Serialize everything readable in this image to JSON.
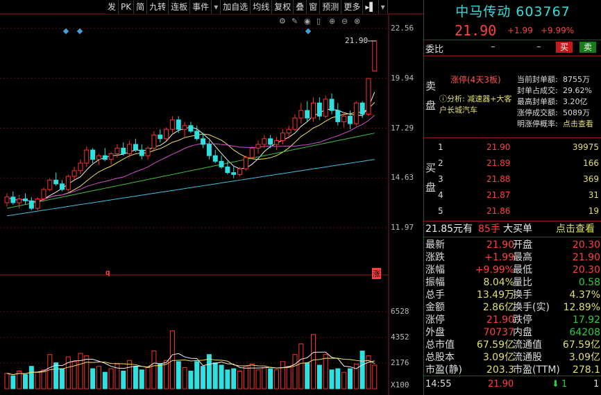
{
  "toolbar": [
    "发",
    "PK",
    "简",
    "九转",
    "连板",
    "事件",
    "▾",
    "加自选",
    "均线",
    "复权",
    "叠",
    "窗",
    "预测",
    "更多",
    "▸▌",
    "▾"
  ],
  "chart_data": {
    "type": "candlestick",
    "price_axis": [
      "22.56",
      "19.94",
      "17.29",
      "14.63",
      "11.97"
    ],
    "volume_axis": [
      "6528",
      "4352",
      "2176"
    ],
    "volume_unit": "X100",
    "high_label": "21.90",
    "markers": [
      "q",
      "涨"
    ],
    "candles": [
      [
        13.3,
        13.8,
        13.1,
        13.6
      ],
      [
        13.6,
        13.9,
        13.2,
        13.3
      ],
      [
        13.3,
        13.7,
        13.0,
        13.5
      ],
      [
        13.5,
        13.8,
        13.2,
        13.4
      ],
      [
        13.4,
        13.6,
        12.9,
        13.0
      ],
      [
        13.0,
        13.6,
        12.9,
        13.5
      ],
      [
        13.5,
        14.1,
        13.4,
        14.0
      ],
      [
        14.0,
        14.6,
        13.9,
        14.5
      ],
      [
        14.5,
        14.9,
        14.2,
        14.3
      ],
      [
        14.3,
        14.5,
        13.9,
        14.0
      ],
      [
        14.0,
        14.8,
        13.9,
        14.7
      ],
      [
        14.7,
        15.2,
        14.5,
        15.0
      ],
      [
        15.0,
        15.6,
        14.8,
        15.4
      ],
      [
        15.4,
        16.3,
        15.2,
        16.1
      ],
      [
        16.1,
        16.2,
        15.4,
        15.6
      ],
      [
        15.6,
        15.9,
        15.3,
        15.8
      ],
      [
        15.8,
        16.2,
        15.5,
        15.6
      ],
      [
        15.6,
        16.0,
        15.3,
        15.9
      ],
      [
        15.9,
        16.4,
        15.7,
        16.2
      ],
      [
        16.2,
        16.5,
        15.8,
        15.9
      ],
      [
        15.9,
        16.6,
        15.7,
        16.4
      ],
      [
        16.4,
        16.7,
        16.0,
        16.1
      ],
      [
        16.1,
        16.4,
        15.6,
        15.8
      ],
      [
        15.8,
        16.3,
        15.6,
        16.2
      ],
      [
        16.2,
        17.1,
        16.1,
        16.9
      ],
      [
        16.9,
        17.2,
        16.5,
        16.7
      ],
      [
        16.7,
        17.3,
        16.6,
        17.2
      ],
      [
        17.2,
        17.9,
        17.0,
        17.7
      ],
      [
        17.7,
        17.9,
        17.0,
        17.2
      ],
      [
        17.2,
        17.6,
        16.8,
        17.4
      ],
      [
        17.4,
        17.6,
        17.0,
        17.1
      ],
      [
        17.1,
        17.4,
        16.6,
        16.7
      ],
      [
        16.7,
        17.0,
        16.2,
        16.4
      ],
      [
        16.4,
        16.6,
        15.6,
        15.8
      ],
      [
        15.8,
        16.1,
        15.4,
        15.5
      ],
      [
        15.5,
        15.8,
        15.1,
        15.2
      ],
      [
        15.2,
        15.5,
        14.8,
        14.9
      ],
      [
        14.9,
        15.2,
        14.6,
        14.8
      ],
      [
        14.8,
        15.2,
        14.7,
        15.1
      ],
      [
        15.1,
        15.8,
        15.0,
        15.7
      ],
      [
        15.7,
        16.3,
        15.6,
        16.2
      ],
      [
        16.2,
        16.6,
        15.9,
        16.4
      ],
      [
        16.4,
        16.9,
        16.2,
        16.7
      ],
      [
        16.7,
        16.9,
        16.2,
        16.4
      ],
      [
        16.4,
        16.8,
        16.1,
        16.6
      ],
      [
        16.6,
        17.2,
        16.4,
        17.0
      ],
      [
        17.0,
        17.4,
        16.7,
        17.2
      ],
      [
        17.2,
        18.0,
        17.1,
        17.8
      ],
      [
        17.8,
        18.6,
        17.5,
        18.2
      ],
      [
        18.2,
        18.7,
        17.6,
        17.8
      ],
      [
        17.8,
        18.9,
        17.6,
        18.6
      ],
      [
        18.6,
        18.9,
        17.7,
        17.9
      ],
      [
        17.9,
        19.0,
        17.8,
        18.8
      ],
      [
        18.8,
        19.1,
        18.0,
        18.2
      ],
      [
        18.2,
        18.6,
        17.4,
        17.6
      ],
      [
        17.6,
        18.1,
        17.3,
        17.9
      ],
      [
        17.9,
        18.2,
        17.2,
        17.5
      ],
      [
        17.5,
        18.7,
        17.4,
        18.6
      ],
      [
        18.6,
        18.7,
        17.8,
        18.0
      ],
      [
        18.0,
        19.9,
        17.9,
        19.9
      ],
      [
        20.3,
        21.9,
        20.3,
        21.9
      ]
    ],
    "volumes": [
      1300,
      1100,
      1500,
      1200,
      1900,
      1400,
      1600,
      2900,
      2200,
      1700,
      2700,
      2300,
      3000,
      2800,
      1700,
      1900,
      1400,
      1700,
      2100,
      1500,
      2400,
      1900,
      1600,
      1800,
      3200,
      2100,
      2400,
      4900,
      2300,
      1800,
      1500,
      2300,
      1900,
      2900,
      2200,
      2000,
      1600,
      1700,
      1500,
      1900,
      2100,
      1600,
      1800,
      1700,
      1600,
      2300,
      1900,
      2900,
      3800,
      2200,
      4600,
      2000,
      2900,
      1600,
      1700,
      1400,
      1700,
      2100,
      3200,
      2800,
      2000
    ]
  },
  "panel": {
    "title": "中马传动 603767",
    "price": "21.90",
    "change": "+1.99",
    "change_pct": "+9.99%",
    "weibi_label": "委比",
    "weibi_val1": "–",
    "weibi_val2": "–",
    "buy_btn": "买",
    "sell_btn": "卖",
    "sell_side": [
      "卖",
      "盘"
    ],
    "buy_side": [
      "买",
      "盘"
    ],
    "limit_up": "涨停(4天3板)",
    "analysis": "ⓘ分析: 减速器+大客户长城汽车",
    "stats": [
      [
        "当前封单额:",
        "8755万"
      ],
      [
        "封单占成交:",
        "29.62%"
      ],
      [
        "最高封单额:",
        "3.20亿"
      ],
      [
        "涨停成交额:",
        "5089万"
      ],
      [
        "明涨停概率:",
        "点击查看"
      ]
    ],
    "bids": [
      [
        "1",
        "21.90",
        "39975"
      ],
      [
        "2",
        "21.89",
        "166"
      ],
      [
        "3",
        "21.88",
        "369"
      ],
      [
        "4",
        "21.87",
        "31"
      ],
      [
        "5",
        "21.86",
        "19"
      ]
    ],
    "big_trade": {
      "price": "21.85元有",
      "vol": "85手",
      "text": "大买单",
      "link": "点击查看"
    },
    "quote": [
      [
        "最新",
        "21.90",
        "开盘",
        "20.30"
      ],
      [
        "涨跌",
        "+1.99",
        "最高",
        "21.90"
      ],
      [
        "涨幅",
        "+9.99%",
        "最低",
        "20.30"
      ],
      [
        "振幅",
        "8.04%",
        "量比",
        "0.58"
      ],
      [
        "总手",
        "13.49万",
        "换手",
        "4.37%"
      ],
      [
        "金额",
        "2.86亿",
        "换手(实)",
        "12.89%"
      ],
      [
        "涨停",
        "21.90",
        "跌停",
        "17.92"
      ],
      [
        "外盘",
        "70737",
        "内盘",
        "64208"
      ],
      [
        "总市值",
        "67.59亿",
        "流通值",
        "67.59亿"
      ],
      [
        "总股本",
        "3.09亿",
        "流通股",
        "3.09亿"
      ],
      [
        "市盈(静)",
        "203.3",
        "市盈(TTM)",
        "278.1"
      ]
    ],
    "tick": {
      "time": "14:55",
      "price": "21.90",
      "vol": "1",
      "n": "1"
    }
  }
}
